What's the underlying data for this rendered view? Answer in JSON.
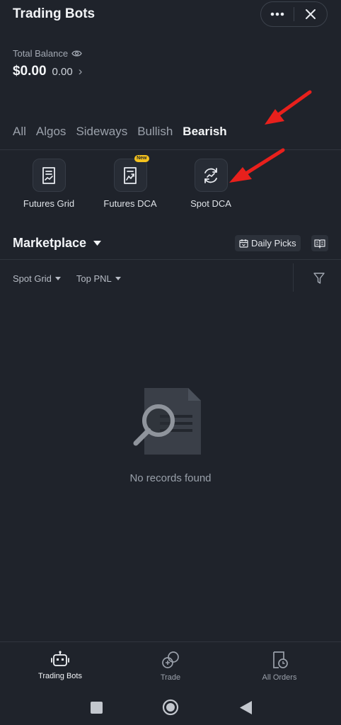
{
  "header": {
    "title": "Trading Bots"
  },
  "balance": {
    "label": "Total Balance",
    "value": "$0.00",
    "sub_value": "0.00",
    "chevron": "›"
  },
  "categories": [
    {
      "label": "All",
      "active": false
    },
    {
      "label": "Algos",
      "active": false
    },
    {
      "label": "Sideways",
      "active": false
    },
    {
      "label": "Bullish",
      "active": false
    },
    {
      "label": "Bearish",
      "active": true
    }
  ],
  "bots": [
    {
      "label": "Futures Grid",
      "icon": "futures-grid-icon"
    },
    {
      "label": "Futures DCA",
      "icon": "futures-dca-icon",
      "badge": "New"
    },
    {
      "label": "Spot DCA",
      "icon": "spot-dca-icon"
    }
  ],
  "marketplace": {
    "title": "Marketplace",
    "daily_picks": "Daily Picks"
  },
  "filters": {
    "grid_type": "Spot Grid",
    "sort": "Top PNL"
  },
  "empty_state": {
    "message": "No records found"
  },
  "bottom_nav": [
    {
      "label": "Trading Bots",
      "icon": "robot-icon",
      "active": true
    },
    {
      "label": "Trade",
      "icon": "trade-icon",
      "active": false
    },
    {
      "label": "All Orders",
      "icon": "orders-icon",
      "active": false
    }
  ],
  "colors": {
    "background": "#1f232b",
    "annotation_arrow": "#e8201c",
    "badge": "#f4c21e"
  }
}
